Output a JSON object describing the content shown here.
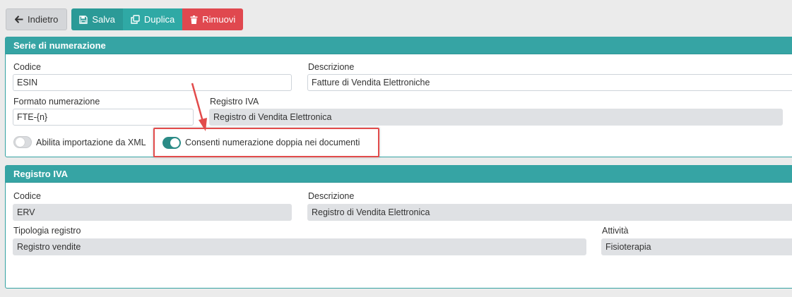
{
  "toolbar": {
    "back_label": "Indietro",
    "save_label": "Salva",
    "duplicate_label": "Duplica",
    "remove_label": "Rimuovi"
  },
  "numbering": {
    "title": "Serie di numerazione",
    "codice_label": "Codice",
    "codice_value": "ESIN",
    "descrizione_label": "Descrizione",
    "descrizione_value": "Fatture di Vendita Elettroniche",
    "formato_label": "Formato numerazione",
    "formato_value": "FTE-{n}",
    "registro_label": "Registro IVA",
    "registro_value": "Registro di Vendita Elettronica",
    "toggle_xml_label": "Abilita importazione da XML",
    "toggle_xml_on": false,
    "toggle_double_label": "Consenti numerazione doppia nei documenti",
    "toggle_double_on": true
  },
  "vat_register": {
    "title": "Registro IVA",
    "codice_label": "Codice",
    "codice_value": "ERV",
    "descrizione_label": "Descrizione",
    "descrizione_value": "Registro di Vendita Elettronica",
    "tipologia_label": "Tipologia registro",
    "tipologia_value": "Registro vendite",
    "attivita_label": "Attività",
    "attivita_value": "Fisioterapia"
  },
  "colors": {
    "accent": "#36a4a4",
    "danger": "#e0484f",
    "annotation": "#e24b4b"
  }
}
